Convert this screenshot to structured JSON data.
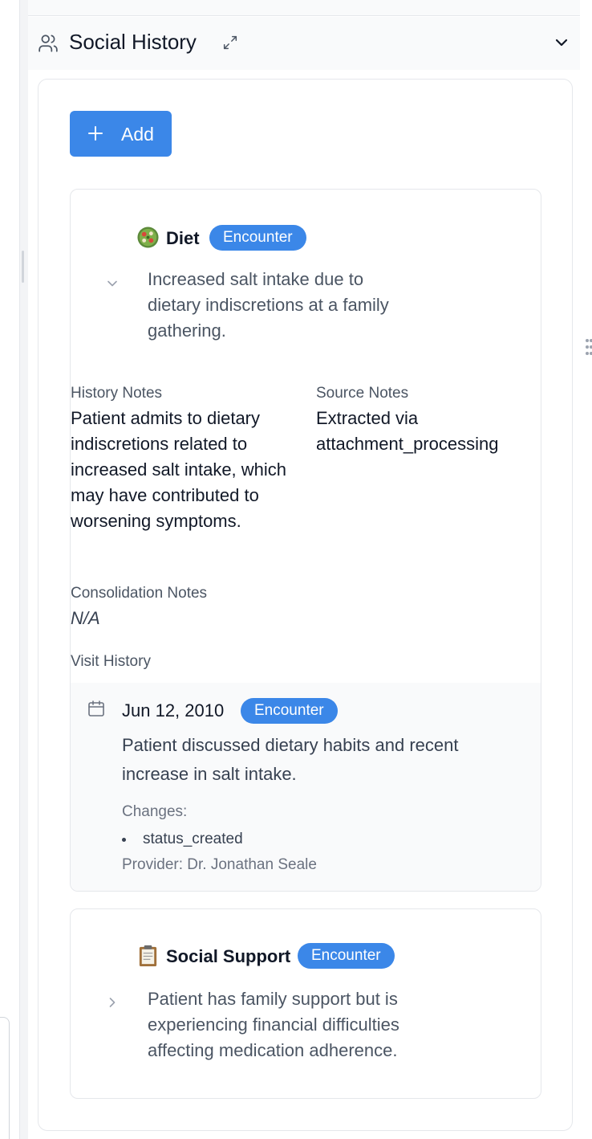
{
  "section": {
    "title": "Social History",
    "icon": "users-icon"
  },
  "add_button": {
    "label": "Add"
  },
  "items": [
    {
      "emoji": "🥗",
      "title": "Diet",
      "badge": "Encounter",
      "summary": "Increased salt intake due to dietary indiscretions at a family gathering.",
      "expanded": true,
      "history_notes_label": "History Notes",
      "history_notes": "Patient admits to dietary indiscretions related to increased salt intake, which may have contributed to worsening symptoms.",
      "source_notes_label": "Source Notes",
      "source_notes": "Extracted via attachment_processing",
      "consolidation_notes_label": "Consolidation Notes",
      "consolidation_notes": "N/A",
      "visit_history_label": "Visit History",
      "visits": [
        {
          "date": "Jun 12, 2010",
          "badge": "Encounter",
          "description": "Patient discussed dietary habits and recent increase in salt intake.",
          "changes_label": "Changes:",
          "changes": [
            "status_created"
          ],
          "provider": "Provider: Dr. Jonathan Seale"
        }
      ]
    },
    {
      "emoji": "📋",
      "title": "Social Support",
      "badge": "Encounter",
      "summary": "Patient has family support but is experiencing financial difficulties affecting medication adherence.",
      "expanded": false
    }
  ],
  "colors": {
    "accent": "#3b87e8",
    "panel_bg": "#f9fafb",
    "border": "#e5e7eb"
  }
}
